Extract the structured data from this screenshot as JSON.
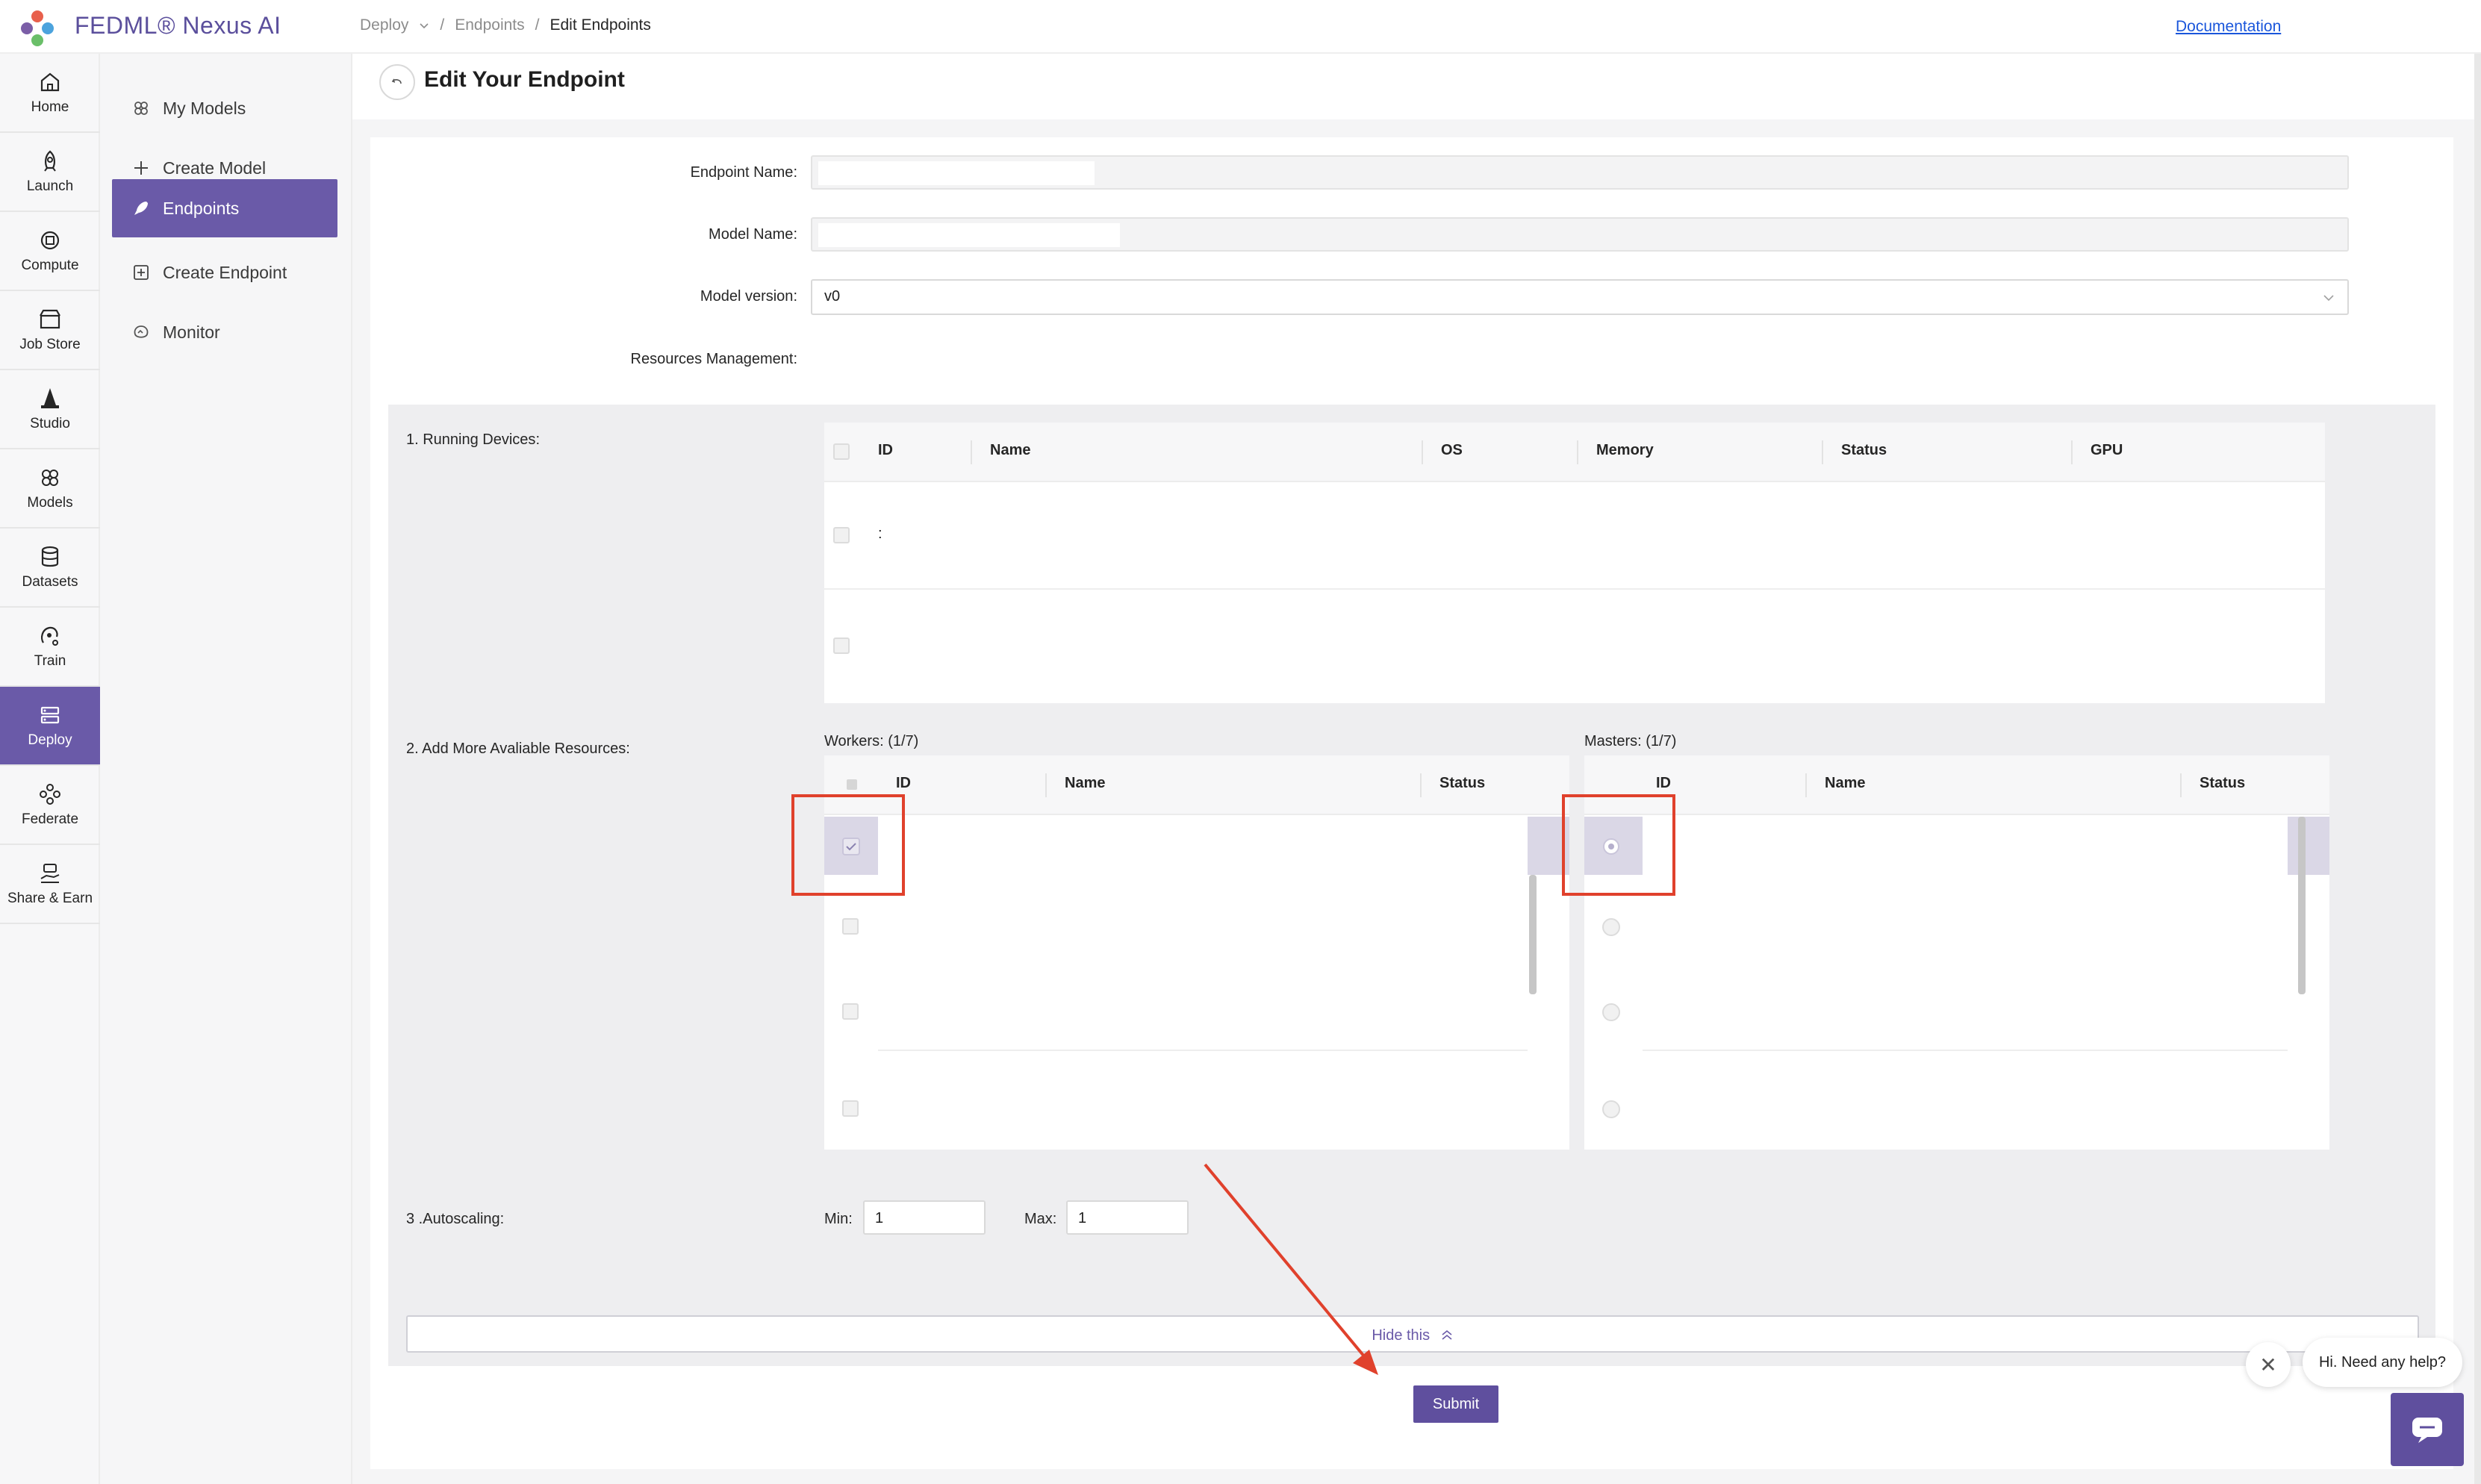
{
  "app": {
    "title": "FEDML® Nexus AI"
  },
  "breadcrumb": {
    "items": [
      "Deploy",
      "Endpoints",
      "Edit Endpoints"
    ],
    "separator": "/"
  },
  "header": {
    "doc_link": "Documentation"
  },
  "leftnav": {
    "items": [
      {
        "label": "Home",
        "icon": "home-icon"
      },
      {
        "label": "Launch",
        "icon": "rocket-icon"
      },
      {
        "label": "Compute",
        "icon": "chip-icon"
      },
      {
        "label": "Job Store",
        "icon": "store-icon"
      },
      {
        "label": "Studio",
        "icon": "wizard-hat-icon"
      },
      {
        "label": "Models",
        "icon": "models-icon"
      },
      {
        "label": "Datasets",
        "icon": "database-icon"
      },
      {
        "label": "Train",
        "icon": "train-icon"
      },
      {
        "label": "Deploy",
        "icon": "deploy-icon"
      },
      {
        "label": "Federate",
        "icon": "federate-icon"
      },
      {
        "label": "Share & Earn",
        "icon": "share-icon"
      }
    ],
    "active": "Deploy"
  },
  "submenu": {
    "items": [
      {
        "label": "My Models",
        "icon": "models-icon"
      },
      {
        "label": "Create Model",
        "icon": "plus-icon"
      },
      {
        "label": "Endpoints",
        "icon": "rocket-icon"
      },
      {
        "label": "Create Endpoint",
        "icon": "plus-square-icon"
      },
      {
        "label": "Monitor",
        "icon": "monitor-icon"
      }
    ],
    "active": "Endpoints"
  },
  "page": {
    "title": "Edit Your Endpoint"
  },
  "form": {
    "endpoint_name_label": "Endpoint Name",
    "model_name_label": "Model Name",
    "model_version_label": "Model version",
    "model_version_value": "v0",
    "resources_label": "Resources Management",
    "colon": ":"
  },
  "running_devices": {
    "label": "1. Running Devices",
    "columns": [
      "ID",
      "Name",
      "OS",
      "Memory",
      "Status",
      "GPU"
    ],
    "row_text": ":"
  },
  "add_resources": {
    "label": "2. Add More Avaliable Resources",
    "workers_label": "Workers: (1/7)",
    "masters_label": "Masters: (1/7)",
    "worker_columns": [
      "ID",
      "Name",
      "Status"
    ],
    "master_columns": [
      "ID",
      "Name",
      "Status"
    ]
  },
  "autoscaling": {
    "label": "3 .Autoscaling",
    "min_label": "Min:",
    "min_value": "1",
    "max_label": "Max:",
    "max_value": "1"
  },
  "hide_bar": {
    "label": "Hide this"
  },
  "actions": {
    "submit_label": "Submit"
  },
  "help": {
    "bubble": "Hi. Need any help?",
    "close": "✕"
  },
  "colors": {
    "accent": "#6a5aa8",
    "annotation": "#e0412c",
    "link": "#1a56db"
  }
}
